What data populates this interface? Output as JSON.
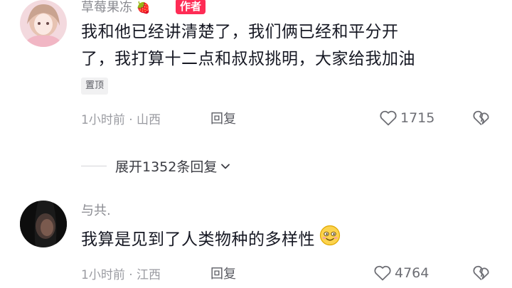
{
  "comments": [
    {
      "username": "草莓果冻",
      "username_emoji": "🍓",
      "author_badge": "作者",
      "text_line1": "我和他已经讲清楚了，我们俩已经和平分开",
      "text_line2": "了，我打算十二点和叔叔挑明，大家给我加油",
      "pinned_label": "置顶",
      "time": "1小时前",
      "separator": "·",
      "location": "山西",
      "reply_label": "回复",
      "likes": "1715"
    },
    {
      "username": "与共.",
      "text": "我算是见到了人类物种的多样性",
      "trailing_emoji": "smiling-face-emoji",
      "time": "1小时前",
      "separator": "·",
      "location": "江西",
      "reply_label": "回复",
      "likes": "4764"
    }
  ],
  "expand_replies": {
    "label": "展开1352条回复"
  },
  "colors": {
    "author_badge": "#fe2c55",
    "meta_text": "#9a9ba1",
    "body_text": "#161823"
  }
}
